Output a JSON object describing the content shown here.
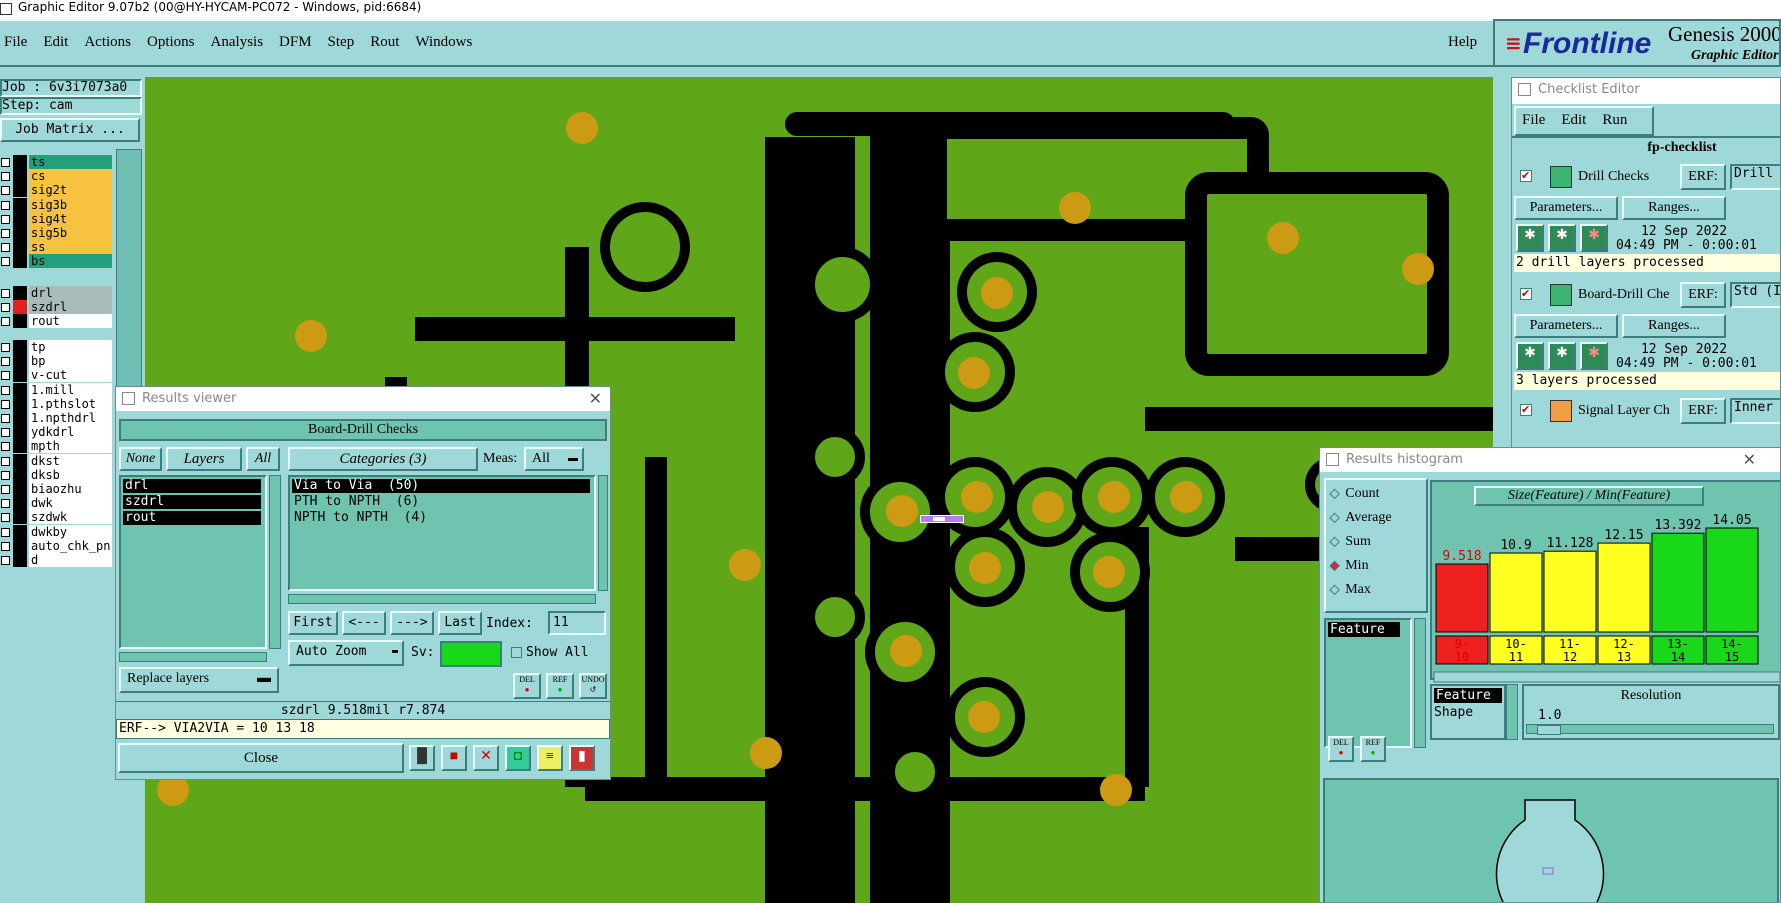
{
  "app": {
    "title": "Graphic Editor 9.07b2 (00@HY-HYCAM-PC072 - Windows, pid:6684)",
    "menu": [
      "File",
      "Edit",
      "Actions",
      "Options",
      "Analysis",
      "DFM",
      "Step",
      "Rout",
      "Windows"
    ],
    "help": "Help",
    "brand": "Frontline",
    "product": "Genesis 2000",
    "product_sub": "Graphic Editor"
  },
  "job": {
    "job_label": "Job : 6v3i7073a0",
    "step_label": "Step: cam",
    "matrix_button": "Job Matrix ..."
  },
  "layers": {
    "group1": [
      {
        "name": "ts",
        "color": "#23a07b"
      },
      {
        "name": "cs",
        "color": "#f6c240"
      },
      {
        "name": "sig2t",
        "color": "#f6c240"
      },
      {
        "name": "sig3b",
        "color": "#f6c240"
      },
      {
        "name": "sig4t",
        "color": "#f6c240"
      },
      {
        "name": "sig5b",
        "color": "#f6c240"
      },
      {
        "name": "ss",
        "color": "#f6c240"
      },
      {
        "name": "bs",
        "color": "#23a07b"
      }
    ],
    "group2": [
      {
        "name": "drl",
        "color": "#a8bcbc"
      },
      {
        "name": "szdrl",
        "color": "#a8bcbc"
      },
      {
        "name": "rout",
        "color": "#ffffff"
      }
    ],
    "group3": [
      "tp",
      "bp",
      "v-cut",
      "1.mill",
      "1.pthslot",
      "1.npthdrl",
      "ydkdrl",
      "mpth",
      "dkst",
      "dksb",
      "biaozhu",
      "dwk",
      "szdwk",
      "dwkby",
      "auto_chk_pn",
      "d"
    ]
  },
  "results_viewer": {
    "title": "Results viewer",
    "header": "Board-Drill Checks",
    "none": "None",
    "layers": "Layers",
    "all": "All",
    "layer_list": [
      "drl",
      "szdrl",
      "rout"
    ],
    "categories": "Categories (3)",
    "meas_label": "Meas:",
    "meas_value": "All",
    "category_list": [
      "Via to Via  (50)",
      "PTH to NPTH  (6)",
      "NPTH to NPTH  (4)"
    ],
    "first": "First",
    "prev": "<---",
    "next": "--->",
    "last": "Last",
    "index_label": "Index:",
    "index_value": "11",
    "auto_zoom": "Auto Zoom",
    "sv_label": "Sv:",
    "show_all": "Show All",
    "replace_layers": "Replace layers",
    "del": "DEL",
    "ref": "REF",
    "undo": "UNDO",
    "status": "szdrl 9.518mil  r7.874",
    "erf_line": "ERF--> VIA2VIA = 10 13 18",
    "close": "Close"
  },
  "checklist": {
    "title": "Checklist Editor",
    "menu": [
      "File",
      "Edit",
      "Run"
    ],
    "name": "fp-checklist",
    "items": [
      {
        "name": "Drill Checks",
        "erf": "ERF:",
        "erf_value": "Drill",
        "params": "Parameters...",
        "ranges": "Ranges...",
        "date": "12 Sep 2022",
        "time": "04:49 PM - 0:00:01",
        "msg": "2 drill layers processed"
      },
      {
        "name": "Board-Drill Che",
        "erf": "ERF:",
        "erf_value": "Std (I",
        "params": "Parameters...",
        "ranges": "Ranges...",
        "date": "12 Sep 2022",
        "time": "04:49 PM - 0:00:01",
        "msg": "3 layers processed"
      },
      {
        "name": "Signal Layer Ch",
        "erf": "ERF:",
        "erf_value": "Inner"
      }
    ]
  },
  "histogram": {
    "title": "Results histogram",
    "options": [
      "Count",
      "Average",
      "Sum",
      "Min",
      "Max"
    ],
    "selected": "Min",
    "feature_list": [
      "Feature"
    ],
    "chart_title": "Size(Feature) / Min(Feature)",
    "bars": [
      {
        "range": "9-\n10",
        "value": 9.518,
        "label": "9.518",
        "color": "#ee2020"
      },
      {
        "range": "10-\n11",
        "value": 10.9,
        "label": "10.9",
        "color": "#ffff20"
      },
      {
        "range": "11-\n12",
        "value": 11.128,
        "label": "11.128",
        "color": "#ffff20"
      },
      {
        "range": "12-\n13",
        "value": 12.15,
        "label": "12.15",
        "color": "#ffff20"
      },
      {
        "range": "13-\n14",
        "value": 13.392,
        "label": "13.392",
        "color": "#19d719"
      },
      {
        "range": "14-\n15",
        "value": 14.05,
        "label": "14.05",
        "color": "#19d719"
      }
    ],
    "attr_feature": "Feature",
    "attr_shape": "Shape",
    "resolution_label": "Resolution",
    "resolution_value": "1.0",
    "del": "DEL",
    "ref": "REF"
  },
  "chart_data": {
    "type": "bar",
    "categories": [
      "9-10",
      "10-11",
      "11-12",
      "12-13",
      "13-14",
      "14-15"
    ],
    "values": [
      9.518,
      10.9,
      11.128,
      12.15,
      13.392,
      14.05
    ],
    "title": "Size(Feature) / Min(Feature)",
    "xlabel": "",
    "ylabel": ""
  }
}
